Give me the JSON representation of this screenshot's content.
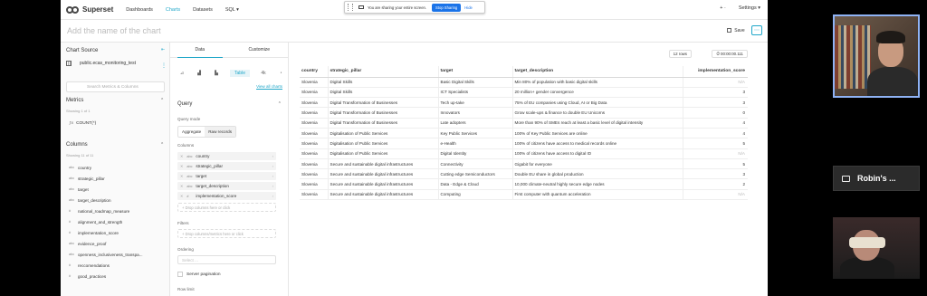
{
  "share_banner": {
    "text": "You are sharing your entire screen.",
    "stop": "Stop Sharing",
    "hide": "Hide"
  },
  "nav": {
    "brand": "Superset",
    "items": [
      "Dashboards",
      "Charts",
      "Datasets",
      "SQL ▾"
    ],
    "active": "Charts",
    "plus": "+ ·",
    "settings": "Settings ▾"
  },
  "header": {
    "chart_name": "Add the name of the chart",
    "save": "Save",
    "more": "⋯"
  },
  "left": {
    "chart_source": "Chart Source",
    "dataset": "public.ecas_monitoring_test",
    "search_placeholder": "Search Metrics & Columns",
    "metrics_title": "Metrics",
    "metrics_note": "Showing 1 of 1",
    "metrics": [
      "COUNT(*)"
    ],
    "columns_title": "Columns",
    "columns_note": "Showing 11 of 11",
    "columns": [
      {
        "type": "abc",
        "name": "country"
      },
      {
        "type": "abc",
        "name": "strategic_pillar"
      },
      {
        "type": "abc",
        "name": "target"
      },
      {
        "type": "abc",
        "name": "target_description"
      },
      {
        "type": "#",
        "name": "national_roadmap_measure"
      },
      {
        "type": "#",
        "name": "alignment_and_strength"
      },
      {
        "type": "#",
        "name": "implementation_score"
      },
      {
        "type": "abc",
        "name": "evidence_proof"
      },
      {
        "type": "abc",
        "name": "openness_inclusiveness_transpa..."
      },
      {
        "type": "#",
        "name": "reccomendations"
      },
      {
        "type": "#",
        "name": "good_practices"
      }
    ]
  },
  "mid": {
    "tabs": [
      "Data",
      "Customize"
    ],
    "viz_icons": [
      "⊿",
      "▟",
      "▙",
      "Table",
      "4k",
      "◔"
    ],
    "viz_selected": "Table",
    "view_all": "View all charts",
    "query_title": "Query",
    "query_mode_label": "Query mode",
    "modes": [
      "Aggregate",
      "Raw records"
    ],
    "mode_selected": "Raw records",
    "columns_label": "Columns",
    "query_columns": [
      {
        "type": "abc",
        "name": "country"
      },
      {
        "type": "abc",
        "name": "strategic_pillar"
      },
      {
        "type": "abc",
        "name": "target"
      },
      {
        "type": "abc",
        "name": "target_description"
      },
      {
        "type": "#",
        "name": "implementation_score"
      }
    ],
    "drop_columns": "+ Drop columns here or click",
    "filters_label": "Filters",
    "drop_filters": "+ Drop columns/metrics here or click",
    "ordering_label": "Ordering",
    "ordering_placeholder": "Select ...",
    "server_pagination": "Server pagination",
    "row_limit_label": "Row limit"
  },
  "results": {
    "rows_badge": "12 rows",
    "timer_badge": "⏱ 00:00:00.111",
    "columns": [
      "country",
      "strategic_pillar",
      "target",
      "target_description",
      "implementation_score"
    ],
    "rows": [
      [
        "Slovenia",
        "Digital Skills",
        "Basic Digital Skills",
        "Min 80% of population with basic digital skills",
        "N/A"
      ],
      [
        "Slovenia",
        "Digital Skills",
        "ICT Specialists",
        "20 million+ gender convergence",
        "3"
      ],
      [
        "Slovenia",
        "Digital Transformation of Businesses",
        "Tech up-take",
        "75% of EU companies using Cloud, AI or Big Data",
        "3"
      ],
      [
        "Slovenia",
        "Digital Transformation of Businesses",
        "Innovators",
        "Grow scale-ups & finance to double EU Unicorns",
        "0"
      ],
      [
        "Slovenia",
        "Digital Transformation of Businesses",
        "Late adopters",
        "More than 90% of SMEs reach at least a basic level of digital intensity",
        "4"
      ],
      [
        "Slovenia",
        "Digitalisation of Public Services",
        "Key Public Services",
        "100% of Key Public Services are online",
        "4"
      ],
      [
        "Slovenia",
        "Digitalisation of Public Services",
        "e-Health",
        "100% of citizens have access to medical records online",
        "5"
      ],
      [
        "Slovenia",
        "Digitalisation of Public Services",
        "Digital Identity",
        "100% of citizens have access to digital ID",
        "N/A"
      ],
      [
        "Slovenia",
        "Secure and sustainable digital infrastructures",
        "Connectivity",
        "Gigabit for everyone",
        "5"
      ],
      [
        "Slovenia",
        "Secure and sustainable digital infrastructures",
        "Cutting edge Semiconductors",
        "Double EU share in global production",
        "3"
      ],
      [
        "Slovenia",
        "Secure and sustainable digital infrastructures",
        "Data - Edge & Cloud",
        "10,000 climate-neutral highly secure edge nodes",
        "2"
      ],
      [
        "Slovenia",
        "Secure and sustainable digital infrastructures",
        "Computing",
        "First computer with quantum acceleration",
        "N/A"
      ]
    ]
  },
  "participants": {
    "name_tile": "Robin's ..."
  }
}
